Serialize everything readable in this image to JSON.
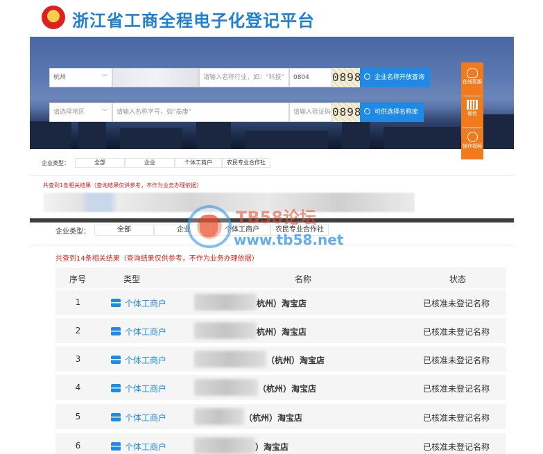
{
  "header": {
    "title": "浙江省工商全程电子化登记平台"
  },
  "search": {
    "row1": {
      "region": "杭州",
      "keyword_placeholder": "请输入名称行业，如：“科技”",
      "captcha_input": "0804",
      "captcha_image": "0898",
      "button": "企业名称开放查询"
    },
    "row2": {
      "region_placeholder": "请选择地区",
      "keyword_placeholder": "请输入名称字号，如“泰康”",
      "captcha_placeholder": "请输入验证码",
      "captcha_image": "0898",
      "button": "可供选择名称库"
    }
  },
  "side_widget": {
    "items": [
      {
        "label": "在线客服",
        "icon": "headset-icon"
      },
      {
        "label": "微信",
        "icon": "qrcode-icon"
      },
      {
        "label": "操作视频",
        "icon": "play-icon"
      }
    ]
  },
  "filter_top": {
    "label": "企业类型：",
    "tabs": [
      "全部",
      "企业",
      "个体工商户",
      "农民专业合作社"
    ],
    "result_text": "共查到1条相关结果（查询结果仅供参考，不作为业务办理依据）"
  },
  "filter_main": {
    "label": "企业类型：",
    "tabs": [
      "全部",
      "企业",
      "个体工商户",
      "农民专业合作社"
    ],
    "result_text": "共查到14条相关结果（查询结果仅供参考，不作为业务办理依据）"
  },
  "table": {
    "headers": [
      "序号",
      "类型",
      "名称",
      "状态"
    ],
    "rows": [
      {
        "no": "1",
        "type": "个体工商户",
        "name": "杭州）淘宝店",
        "status": "已核准未登记名称"
      },
      {
        "no": "2",
        "type": "个体工商户",
        "name": "杭州）淘宝店",
        "status": "已核准未登记名称"
      },
      {
        "no": "3",
        "type": "个体工商户",
        "name": "（杭州）淘宝店",
        "status": "已核准未登记名称"
      },
      {
        "no": "4",
        "type": "个体工商户",
        "name": "（杭州）淘宝店",
        "status": "已核准未登记名称"
      },
      {
        "no": "5",
        "type": "个体工商户",
        "name": "（杭州）淘宝店",
        "status": "已核准未登记名称"
      },
      {
        "no": "6",
        "type": "个体工商户",
        "name": "）淘宝店",
        "status": "已核准未登记名称"
      }
    ]
  },
  "watermark": {
    "title": "TB58论坛",
    "url": "www.tb58.net"
  },
  "colors": {
    "accent": "#1e8ae6",
    "orange": "#f07b1e",
    "red": "#d9231c"
  }
}
